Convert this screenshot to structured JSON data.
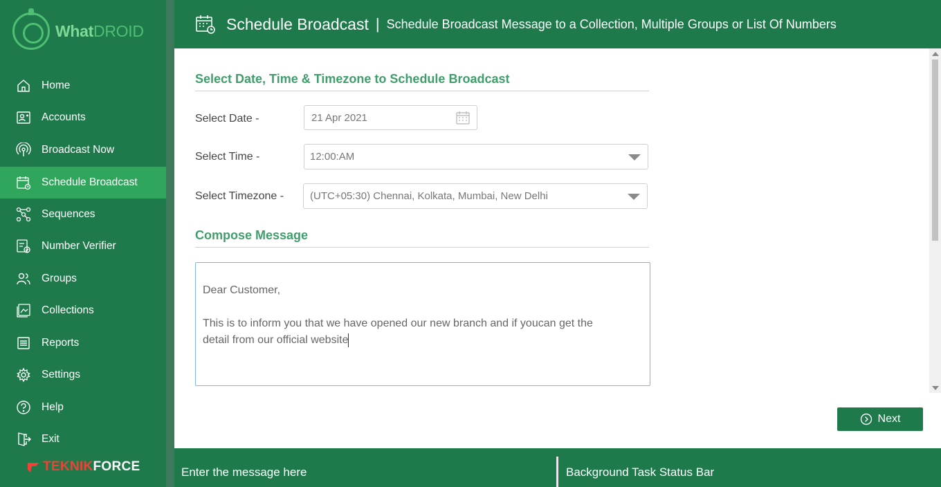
{
  "app": {
    "name_part1": "What",
    "name_part2": "DROID"
  },
  "brand_bottom": {
    "part1": "TEKNIK",
    "part2": "FORCE"
  },
  "sidebar": {
    "items": [
      {
        "label": "Home",
        "icon": "home-icon"
      },
      {
        "label": "Accounts",
        "icon": "accounts-icon"
      },
      {
        "label": "Broadcast Now",
        "icon": "broadcast-icon"
      },
      {
        "label": "Schedule Broadcast",
        "icon": "calendar-icon",
        "active": true
      },
      {
        "label": "Sequences",
        "icon": "sequences-icon"
      },
      {
        "label": "Number Verifier",
        "icon": "number-verifier-icon"
      },
      {
        "label": "Groups",
        "icon": "groups-icon"
      },
      {
        "label": "Collections",
        "icon": "collections-icon"
      },
      {
        "label": "Reports",
        "icon": "reports-icon"
      },
      {
        "label": "Settings",
        "icon": "gear-icon"
      },
      {
        "label": "Help",
        "icon": "help-icon"
      },
      {
        "label": "Exit",
        "icon": "exit-icon"
      }
    ]
  },
  "header": {
    "title": "Schedule Broadcast",
    "separator": "|",
    "subtitle": "Schedule Broadcast Message to a Collection, Multiple Groups or List Of Numbers"
  },
  "schedule_section": {
    "title": "Select Date, Time & Timezone to Schedule Broadcast",
    "date_label": "Select Date -",
    "date_value": "21 Apr 2021",
    "time_label": "Select Time -",
    "time_value": "12:00:AM",
    "timezone_label": "Select Timezone -",
    "timezone_value": "(UTC+05:30) Chennai, Kolkata, Mumbai, New Delhi"
  },
  "compose_section": {
    "title": "Compose Message",
    "message_line1": "Dear Customer,",
    "message_line2": "This is to inform you that we have opened our new branch and if youcan get the",
    "message_line3": "detail from our official website"
  },
  "actions": {
    "next_label": "Next"
  },
  "statusbar": {
    "left": "Enter the message here",
    "right": "Background Task Status Bar"
  },
  "colors": {
    "primary": "#1e7a4a",
    "active": "#2fa65c",
    "accent_text": "#3f9e6b",
    "brand_red": "#ef4136"
  }
}
